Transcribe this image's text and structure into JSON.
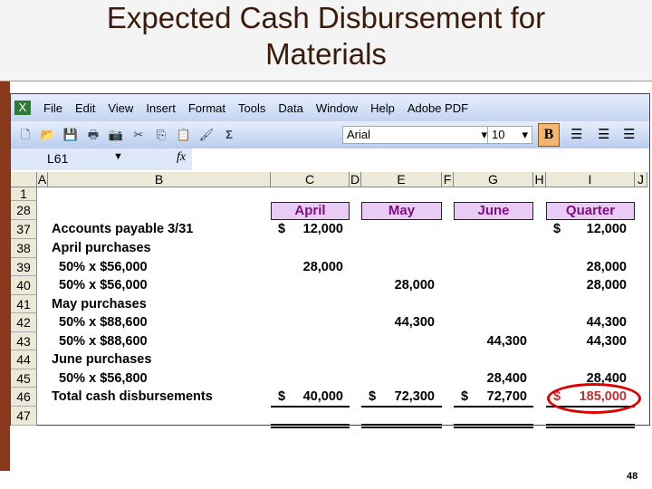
{
  "slide": {
    "title_line1": "Expected Cash Disbursement for",
    "title_line2": "Materials",
    "page_number": "48"
  },
  "menu": [
    "File",
    "Edit",
    "View",
    "Insert",
    "Format",
    "Tools",
    "Data",
    "Window",
    "Help",
    "Adobe PDF"
  ],
  "toolbar": {
    "font": "Arial",
    "size": "10",
    "bold": "B",
    "autosum": "Σ"
  },
  "formula_bar": {
    "name_box": "L61",
    "fx": "fx"
  },
  "columns": [
    "A",
    "B",
    "C",
    "D",
    "E",
    "F",
    "G",
    "H",
    "I",
    "J"
  ],
  "row_numbers": [
    "1",
    "28",
    "37",
    "38",
    "39",
    "40",
    "41",
    "42",
    "43",
    "44",
    "45",
    "46",
    "47"
  ],
  "month_headers": [
    "April",
    "May",
    "June",
    "Quarter"
  ],
  "rows": [
    {
      "label": "Accounts payable 3/31",
      "april": "$   12,000",
      "may": "",
      "june": "",
      "quarter": "$     12,000"
    },
    {
      "label": "April purchases",
      "april": "",
      "may": "",
      "june": "",
      "quarter": ""
    },
    {
      "label": "  50% x $56,000",
      "april": "28,000",
      "may": "",
      "june": "",
      "quarter": "28,000"
    },
    {
      "label": "  50% x $56,000",
      "april": "",
      "may": "28,000",
      "june": "",
      "quarter": "28,000"
    },
    {
      "label": "May purchases",
      "april": "",
      "may": "",
      "june": "",
      "quarter": ""
    },
    {
      "label": "  50% x $88,600",
      "april": "",
      "may": "44,300",
      "june": "",
      "quarter": "44,300"
    },
    {
      "label": "  50% x $88,600",
      "april": "",
      "may": "",
      "june": "44,300",
      "quarter": "44,300"
    },
    {
      "label": "June purchases",
      "april": "",
      "may": "",
      "june": "",
      "quarter": ""
    },
    {
      "label": "  50% x $56,800",
      "april": "",
      "may": "",
      "june": "28,400",
      "quarter": "28,400"
    },
    {
      "label": "Total cash disbursements",
      "april": "$   40,000",
      "may": "$   72,300",
      "june": "$   72,700",
      "quarter": "$   185,000"
    }
  ],
  "colors": {
    "header_fill": "#e8ccf6",
    "header_text": "#80107f",
    "highlight": "#d00000"
  }
}
